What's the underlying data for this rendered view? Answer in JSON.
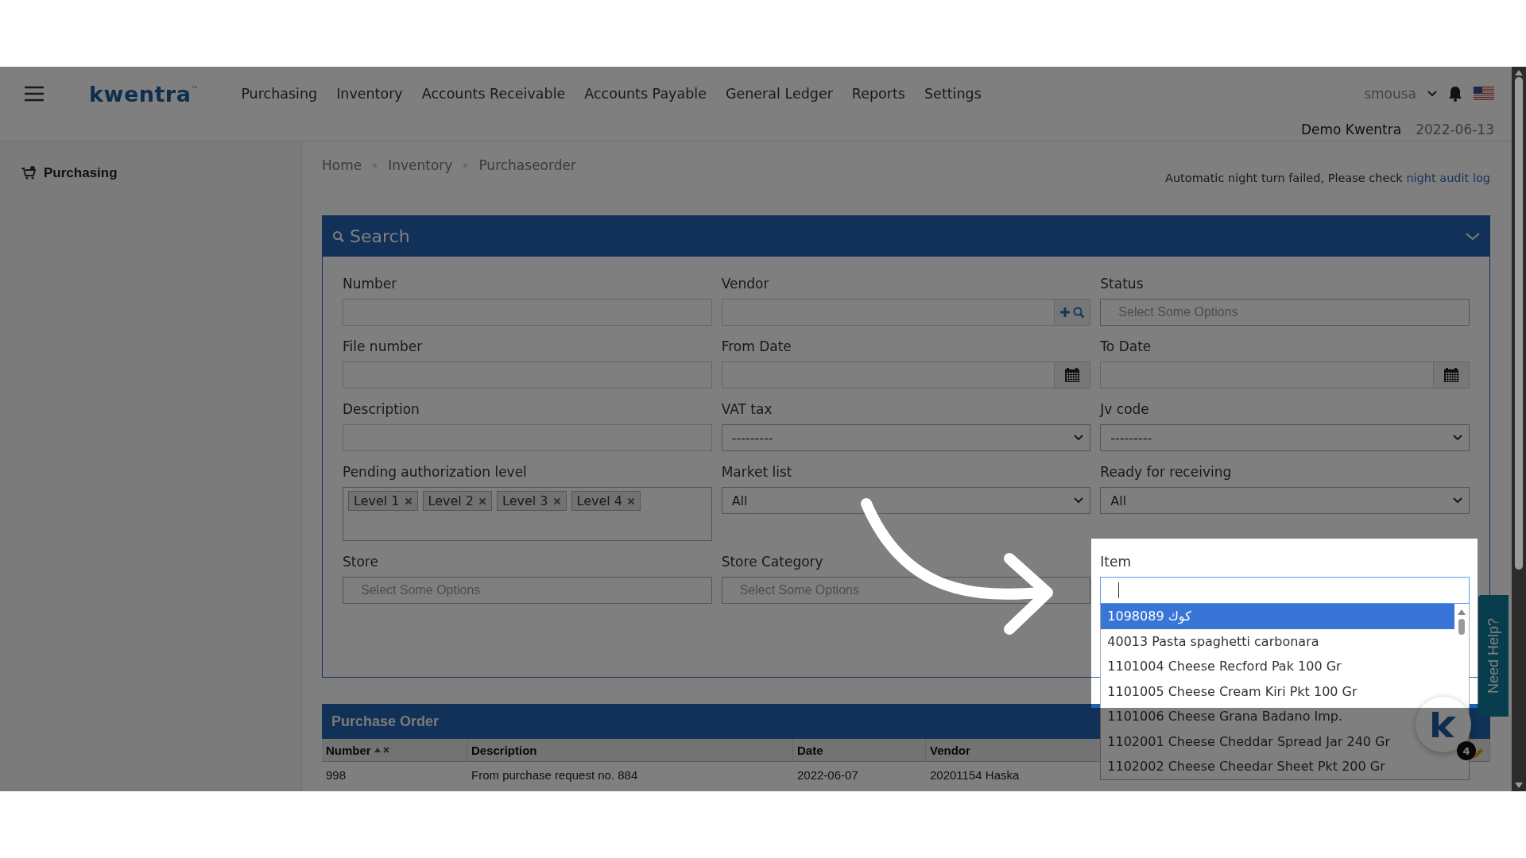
{
  "header": {
    "brand": "kwentra",
    "brand_mark": "™",
    "nav": [
      "Purchasing",
      "Inventory",
      "Accounts Receivable",
      "Accounts Payable",
      "General Ledger",
      "Reports",
      "Settings"
    ],
    "user": "smousa",
    "company": "Demo Kwentra",
    "date": "2022-06-13"
  },
  "sidebar": {
    "items": [
      {
        "label": "Purchasing"
      }
    ]
  },
  "breadcrumbs": [
    "Home",
    "Inventory",
    "Purchaseorder"
  ],
  "notice": {
    "text": "Automatic night turn failed, Please check",
    "link": "night audit log"
  },
  "search_panel": {
    "title": "Search",
    "fields": [
      {
        "kind": "text",
        "label": "Number"
      },
      {
        "kind": "lookup",
        "label": "Vendor"
      },
      {
        "kind": "multiselect",
        "label": "Status",
        "placeholder": "Select Some Options"
      },
      {
        "kind": "text",
        "label": "File number"
      },
      {
        "kind": "date",
        "label": "From Date"
      },
      {
        "kind": "date",
        "label": "To Date"
      },
      {
        "kind": "text",
        "label": "Description"
      },
      {
        "kind": "select",
        "label": "VAT tax",
        "value": "---------"
      },
      {
        "kind": "select",
        "label": "Jv code",
        "value": "---------"
      },
      {
        "kind": "tags",
        "label": "Pending authorization level",
        "tags": [
          "Level 1",
          "Level 2",
          "Level 3",
          "Level 4"
        ]
      },
      {
        "kind": "select",
        "label": "Market list",
        "value": "All"
      },
      {
        "kind": "select",
        "label": "Ready for receiving",
        "value": "All"
      },
      {
        "kind": "multiselect",
        "label": "Store",
        "placeholder": "Select Some Options"
      },
      {
        "kind": "multiselect",
        "label": "Store Category",
        "placeholder": "Select Some Options"
      },
      {
        "kind": "search",
        "label": "Item",
        "options": [
          {
            "label": "1098089 كوك",
            "selected": true
          },
          {
            "label": "40013 Pasta spaghetti carbonara",
            "selected": false
          },
          {
            "label": "1101004 Cheese Recford Pak 100 Gr",
            "selected": false
          },
          {
            "label": "1101005 Cheese Cream Kiri Pkt 100 Gr",
            "selected": false
          },
          {
            "label": "1101006 Cheese Grana Badano Imp.",
            "selected": false
          },
          {
            "label": "1102001 Cheese Cheddar Spread Jar 240 Gr",
            "selected": false
          },
          {
            "label": "1102002 Cheese Cheedar Sheet Pkt 200 Gr",
            "selected": false
          }
        ]
      }
    ]
  },
  "purchase_order": {
    "title": "Purchase Order",
    "columns": [
      {
        "label": "Number",
        "sorted": true
      },
      {
        "label": "Description",
        "sorted": false
      },
      {
        "label": "Date",
        "sorted": false
      },
      {
        "label": "Vendor",
        "sorted": false
      }
    ],
    "rows": [
      [
        "998",
        "From purchase request no. 884",
        "2022-06-07",
        "20201154 Haska"
      ]
    ]
  },
  "help_tab": {
    "label": "Need Help?"
  },
  "chat": {
    "badge": "4"
  }
}
